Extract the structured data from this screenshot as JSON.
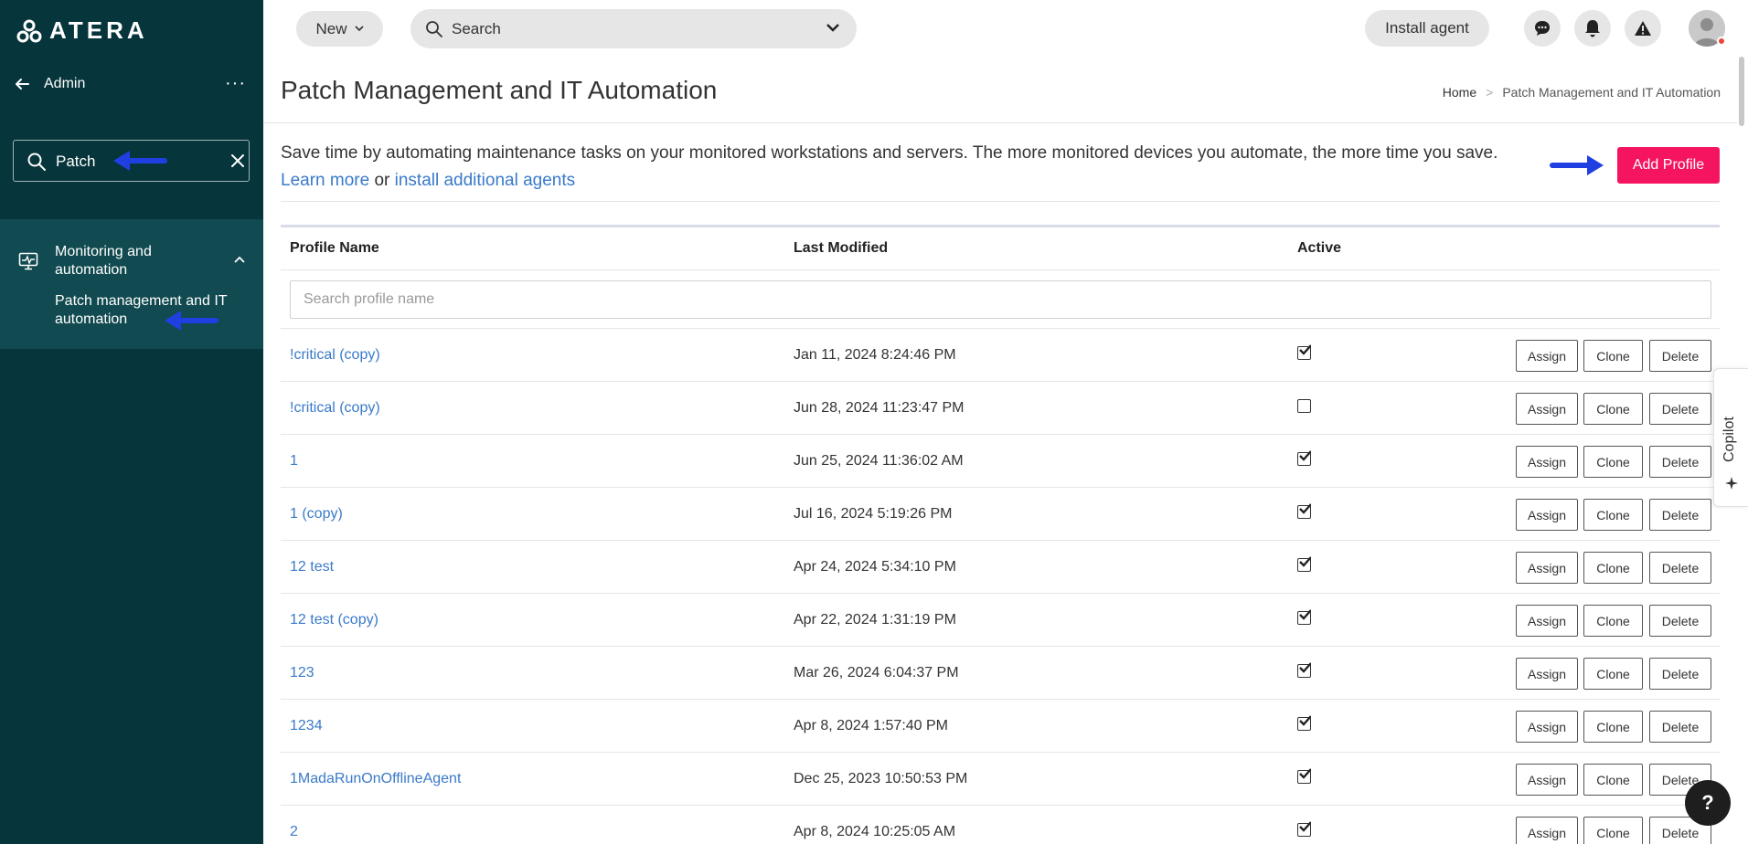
{
  "sidebar": {
    "logo_text": "ATERA",
    "admin_label": "Admin",
    "more_label": "···",
    "search_value": "Patch",
    "group_label": "Monitoring and automation",
    "submenu_label": "Patch management and IT automation"
  },
  "topbar": {
    "new_label": "New",
    "search_placeholder": "Search",
    "install_label": "Install agent"
  },
  "page": {
    "title": "Patch Management and IT Automation",
    "breadcrumb_home": "Home",
    "breadcrumb_sep": ">",
    "breadcrumb_current": "Patch Management and IT Automation",
    "description": "Save time by automating maintenance tasks on your monitored workstations and servers. The more monitored devices you automate, the more time you save.",
    "learn_more": "Learn more",
    "or_text": " or ",
    "install_link": "install additional agents",
    "add_profile": "Add Profile"
  },
  "table": {
    "col_name": "Profile Name",
    "col_modified": "Last Modified",
    "col_active": "Active",
    "filter_placeholder": "Search profile name",
    "assign_label": "Assign",
    "clone_label": "Clone",
    "delete_label": "Delete",
    "rows": [
      {
        "name": "!critical (copy)",
        "modified": "Jan 11, 2024 8:24:46 PM",
        "active": true
      },
      {
        "name": "!critical (copy)",
        "modified": "Jun 28, 2024 11:23:47 PM",
        "active": false
      },
      {
        "name": "1",
        "modified": "Jun 25, 2024 11:36:02 AM",
        "active": true
      },
      {
        "name": "1 (copy)",
        "modified": "Jul 16, 2024 5:19:26 PM",
        "active": true
      },
      {
        "name": "12 test",
        "modified": "Apr 24, 2024 5:34:10 PM",
        "active": true
      },
      {
        "name": "12 test (copy)",
        "modified": "Apr 22, 2024 1:31:19 PM",
        "active": true
      },
      {
        "name": "123",
        "modified": "Mar 26, 2024 6:04:37 PM",
        "active": true
      },
      {
        "name": "1234",
        "modified": "Apr 8, 2024 1:57:40 PM",
        "active": true
      },
      {
        "name": "1MadaRunOnOfflineAgent",
        "modified": "Dec 25, 2023 10:50:53 PM",
        "active": true
      },
      {
        "name": "2",
        "modified": "Apr 8, 2024 10:25:05 AM",
        "active": true
      }
    ]
  },
  "copilot_label": "Copilot",
  "help_label": "?",
  "colors": {
    "sidebar_bg": "#06353b",
    "sidebar_active_bg": "#114a50",
    "accent_pink": "#f5145f",
    "link_blue": "#3a7ac8",
    "annotation_arrow": "#1f3fe0"
  }
}
